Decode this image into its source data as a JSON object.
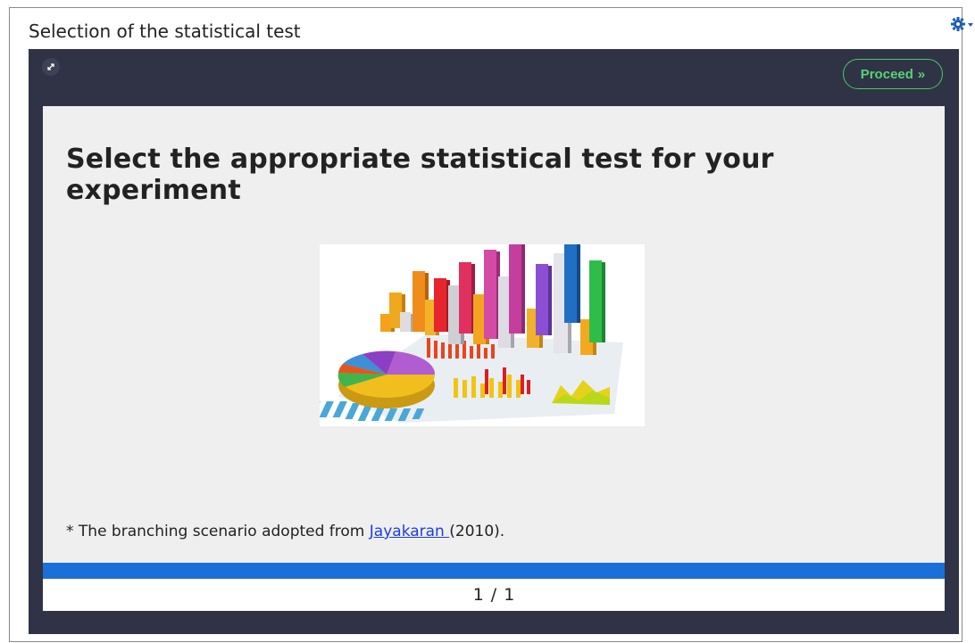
{
  "card": {
    "title": "Selection of the statistical test"
  },
  "icons": {
    "settings": "gear-icon",
    "fullscreen": "expand-icon",
    "proceed": "double-chevron-right-icon"
  },
  "player": {
    "proceed_label": "Proceed",
    "proceed_glyph": "»"
  },
  "slide": {
    "heading": "Select the appropriate statistical test for your experiment",
    "footnote_prefix": "* The branching scenario adopted from ",
    "footnote_link": "Jayakaran ",
    "footnote_suffix": "(2010)."
  },
  "pager": {
    "current": "1",
    "separator": "/",
    "total": "1"
  },
  "colors": {
    "player_bg": "#2f3345",
    "accent_green": "#4cc66a",
    "progress_blue": "#1a6fd8",
    "link_blue": "#1a3fe0"
  }
}
